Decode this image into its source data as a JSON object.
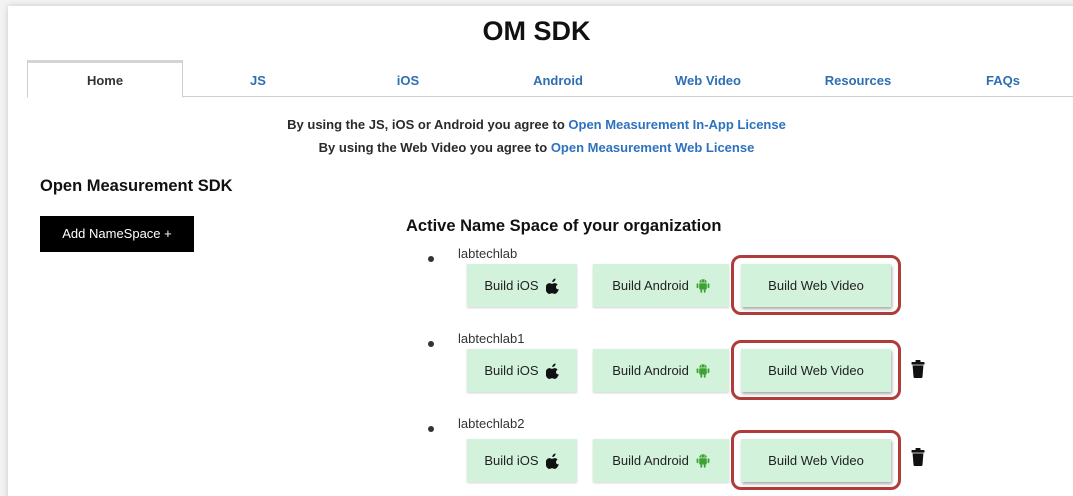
{
  "app": {
    "title": "OM SDK"
  },
  "tabs": [
    {
      "label": "Home",
      "active": true
    },
    {
      "label": "JS"
    },
    {
      "label": "iOS"
    },
    {
      "label": "Android"
    },
    {
      "label": "Web Video"
    },
    {
      "label": "Resources"
    },
    {
      "label": "FAQs"
    }
  ],
  "notice": {
    "line1_text": "By using the JS, iOS or Android you agree to",
    "line1_link": "Open Measurement In-App License",
    "line2_text": "By using the Web Video you agree to",
    "line2_link": "Open Measurement Web License"
  },
  "main": {
    "section_title": "Open Measurement SDK",
    "add_button": "Add NameSpace +",
    "namespaces_title": "Active Name Space of your organization"
  },
  "namespaces": [
    {
      "name": "labtechlab",
      "deletable": false
    },
    {
      "name": "labtechlab1",
      "deletable": true
    },
    {
      "name": "labtechlab2",
      "deletable": true
    }
  ],
  "build_buttons": {
    "ios": "Build iOS",
    "android": "Build Android",
    "web": "Build Web Video"
  },
  "icons": {
    "ios": "apple-icon",
    "android": "android-icon",
    "delete": "trash-icon"
  },
  "colors": {
    "link": "#2d72bf",
    "build_button_bg": "#d2f2dc",
    "android_green": "#3da232",
    "highlight": "#b03b3b",
    "add_button_bg": "#000000"
  }
}
